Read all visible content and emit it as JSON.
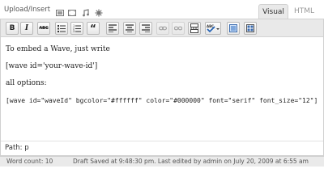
{
  "header": {
    "upload_label": "Upload/Insert",
    "media_icons": [
      "add-image-icon",
      "add-video-icon",
      "add-audio-icon",
      "add-media-icon"
    ],
    "tabs": [
      {
        "label": "Visual",
        "active": true
      },
      {
        "label": "HTML",
        "active": false
      }
    ]
  },
  "toolbar": {
    "buttons": [
      {
        "name": "bold",
        "glyph": "B"
      },
      {
        "name": "italic",
        "glyph": "I"
      },
      {
        "name": "strikethrough",
        "glyph": "ABC"
      },
      {
        "name": "unordered-list",
        "glyph": ""
      },
      {
        "name": "ordered-list",
        "glyph": ""
      },
      {
        "name": "blockquote",
        "glyph": "“"
      },
      {
        "name": "align-left",
        "glyph": ""
      },
      {
        "name": "align-center",
        "glyph": ""
      },
      {
        "name": "align-right",
        "glyph": ""
      },
      {
        "name": "insert-link",
        "glyph": ""
      },
      {
        "name": "unlink",
        "glyph": ""
      },
      {
        "name": "insert-more",
        "glyph": ""
      },
      {
        "name": "spellcheck",
        "glyph": ""
      },
      {
        "name": "fullscreen",
        "glyph": ""
      },
      {
        "name": "kitchen-sink",
        "glyph": ""
      }
    ]
  },
  "content": {
    "line1": "To embed a Wave, just write",
    "line2": "[wave id='your-wave-id']",
    "line3": "all options:",
    "line4": "[wave id=\"waveId\" bgcolor=\"#ffffff\" color=\"#000000\" font=\"serif\" font_size=\"12\"]"
  },
  "path": {
    "text": "Path: p"
  },
  "status": {
    "word_count": "Word count: 10",
    "draft_saved": "Draft Saved at 9:48:30 pm. Last edited by admin on July 20, 2009 at 6:55 am"
  },
  "colors": {
    "toolbar_bg": "#e9e9e9",
    "active_tab_bg": "#e9e9e9",
    "status_bg": "#eaeaea"
  }
}
